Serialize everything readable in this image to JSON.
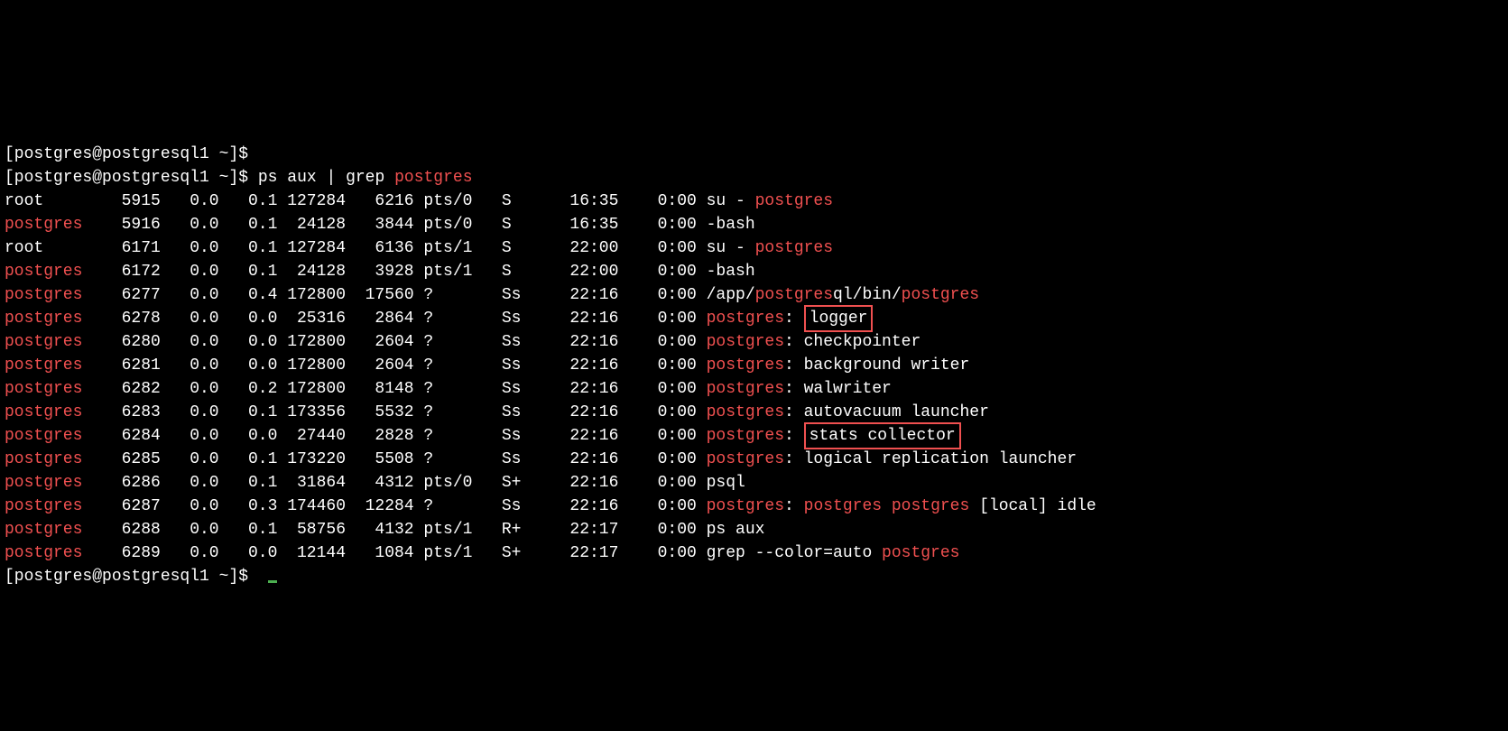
{
  "prompt": {
    "text": "[postgres@postgresql1 ~]$",
    "spacer": " "
  },
  "command": "ps aux | grep postgres",
  "hl": "postgres",
  "rows": [
    {
      "user": "root",
      "user_hl": false,
      "pid": "5915",
      "cpu": "0.0",
      "mem": "0.1",
      "vsz": "127284",
      "rss": "6216",
      "tty": "pts/0",
      "stat": "S",
      "start": "16:35",
      "time": "0:00",
      "cmd_pre": "su - ",
      "cmd_hl": "postgres",
      "cmd_post": "",
      "box": false
    },
    {
      "user": "postgres",
      "user_hl": true,
      "pid": "5916",
      "cpu": "0.0",
      "mem": "0.1",
      "vsz": "24128",
      "rss": "3844",
      "tty": "pts/0",
      "stat": "S",
      "start": "16:35",
      "time": "0:00",
      "cmd_pre": "-bash",
      "cmd_hl": "",
      "cmd_post": "",
      "box": false
    },
    {
      "user": "root",
      "user_hl": false,
      "pid": "6171",
      "cpu": "0.0",
      "mem": "0.1",
      "vsz": "127284",
      "rss": "6136",
      "tty": "pts/1",
      "stat": "S",
      "start": "22:00",
      "time": "0:00",
      "cmd_pre": "su - ",
      "cmd_hl": "postgres",
      "cmd_post": "",
      "box": false
    },
    {
      "user": "postgres",
      "user_hl": true,
      "pid": "6172",
      "cpu": "0.0",
      "mem": "0.1",
      "vsz": "24128",
      "rss": "3928",
      "tty": "pts/1",
      "stat": "S",
      "start": "22:00",
      "time": "0:00",
      "cmd_pre": "-bash",
      "cmd_hl": "",
      "cmd_post": "",
      "box": false
    },
    {
      "user": "postgres",
      "user_hl": true,
      "pid": "6277",
      "cpu": "0.0",
      "mem": "0.4",
      "vsz": "172800",
      "rss": "17560",
      "tty": "?",
      "stat": "Ss",
      "start": "22:16",
      "time": "0:00",
      "cmd_pre": "/app/",
      "cmd_hl": "postgres",
      "cmd_mid": "ql/bin/",
      "cmd_hl2": "postgres",
      "cmd_post": "",
      "box": false,
      "double": true
    },
    {
      "user": "postgres",
      "user_hl": true,
      "pid": "6278",
      "cpu": "0.0",
      "mem": "0.0",
      "vsz": "25316",
      "rss": "2864",
      "tty": "?",
      "stat": "Ss",
      "start": "22:16",
      "time": "0:00",
      "cmd_pre": "",
      "cmd_hl": "postgres",
      "cmd_post": ": ",
      "box": true,
      "box_text": "logger"
    },
    {
      "user": "postgres",
      "user_hl": true,
      "pid": "6280",
      "cpu": "0.0",
      "mem": "0.0",
      "vsz": "172800",
      "rss": "2604",
      "tty": "?",
      "stat": "Ss",
      "start": "22:16",
      "time": "0:00",
      "cmd_pre": "",
      "cmd_hl": "postgres",
      "cmd_post": ": checkpointer",
      "box": false
    },
    {
      "user": "postgres",
      "user_hl": true,
      "pid": "6281",
      "cpu": "0.0",
      "mem": "0.0",
      "vsz": "172800",
      "rss": "2604",
      "tty": "?",
      "stat": "Ss",
      "start": "22:16",
      "time": "0:00",
      "cmd_pre": "",
      "cmd_hl": "postgres",
      "cmd_post": ": background writer",
      "box": false
    },
    {
      "user": "postgres",
      "user_hl": true,
      "pid": "6282",
      "cpu": "0.0",
      "mem": "0.2",
      "vsz": "172800",
      "rss": "8148",
      "tty": "?",
      "stat": "Ss",
      "start": "22:16",
      "time": "0:00",
      "cmd_pre": "",
      "cmd_hl": "postgres",
      "cmd_post": ": walwriter",
      "box": false
    },
    {
      "user": "postgres",
      "user_hl": true,
      "pid": "6283",
      "cpu": "0.0",
      "mem": "0.1",
      "vsz": "173356",
      "rss": "5532",
      "tty": "?",
      "stat": "Ss",
      "start": "22:16",
      "time": "0:00",
      "cmd_pre": "",
      "cmd_hl": "postgres",
      "cmd_post": ": autovacuum launcher",
      "box": false
    },
    {
      "user": "postgres",
      "user_hl": true,
      "pid": "6284",
      "cpu": "0.0",
      "mem": "0.0",
      "vsz": "27440",
      "rss": "2828",
      "tty": "?",
      "stat": "Ss",
      "start": "22:16",
      "time": "0:00",
      "cmd_pre": "",
      "cmd_hl": "postgres",
      "cmd_post": ": ",
      "box": true,
      "box_text": "stats collector"
    },
    {
      "user": "postgres",
      "user_hl": true,
      "pid": "6285",
      "cpu": "0.0",
      "mem": "0.1",
      "vsz": "173220",
      "rss": "5508",
      "tty": "?",
      "stat": "Ss",
      "start": "22:16",
      "time": "0:00",
      "cmd_pre": "",
      "cmd_hl": "postgres",
      "cmd_post": ": logical replication launcher",
      "box": false
    },
    {
      "user": "postgres",
      "user_hl": true,
      "pid": "6286",
      "cpu": "0.0",
      "mem": "0.1",
      "vsz": "31864",
      "rss": "4312",
      "tty": "pts/0",
      "stat": "S+",
      "start": "22:16",
      "time": "0:00",
      "cmd_pre": "psql",
      "cmd_hl": "",
      "cmd_post": "",
      "box": false
    },
    {
      "user": "postgres",
      "user_hl": true,
      "pid": "6287",
      "cpu": "0.0",
      "mem": "0.3",
      "vsz": "174460",
      "rss": "12284",
      "tty": "?",
      "stat": "Ss",
      "start": "22:16",
      "time": "0:00",
      "cmd_pre": "",
      "cmd_hl": "postgres",
      "cmd_post": ": ",
      "cmd_hl2": "postgres",
      "cmd_mid2": " ",
      "cmd_hl3": "postgres",
      "cmd_post2": " [local] idle",
      "triple": true,
      "box": false
    },
    {
      "user": "postgres",
      "user_hl": true,
      "pid": "6288",
      "cpu": "0.0",
      "mem": "0.1",
      "vsz": "58756",
      "rss": "4132",
      "tty": "pts/1",
      "stat": "R+",
      "start": "22:17",
      "time": "0:00",
      "cmd_pre": "ps aux",
      "cmd_hl": "",
      "cmd_post": "",
      "box": false
    },
    {
      "user": "postgres",
      "user_hl": true,
      "pid": "6289",
      "cpu": "0.0",
      "mem": "0.0",
      "vsz": "12144",
      "rss": "1084",
      "tty": "pts/1",
      "stat": "S+",
      "start": "22:17",
      "time": "0:00",
      "cmd_pre": "grep --color=auto ",
      "cmd_hl": "postgres",
      "cmd_post": "",
      "box": false
    }
  ]
}
